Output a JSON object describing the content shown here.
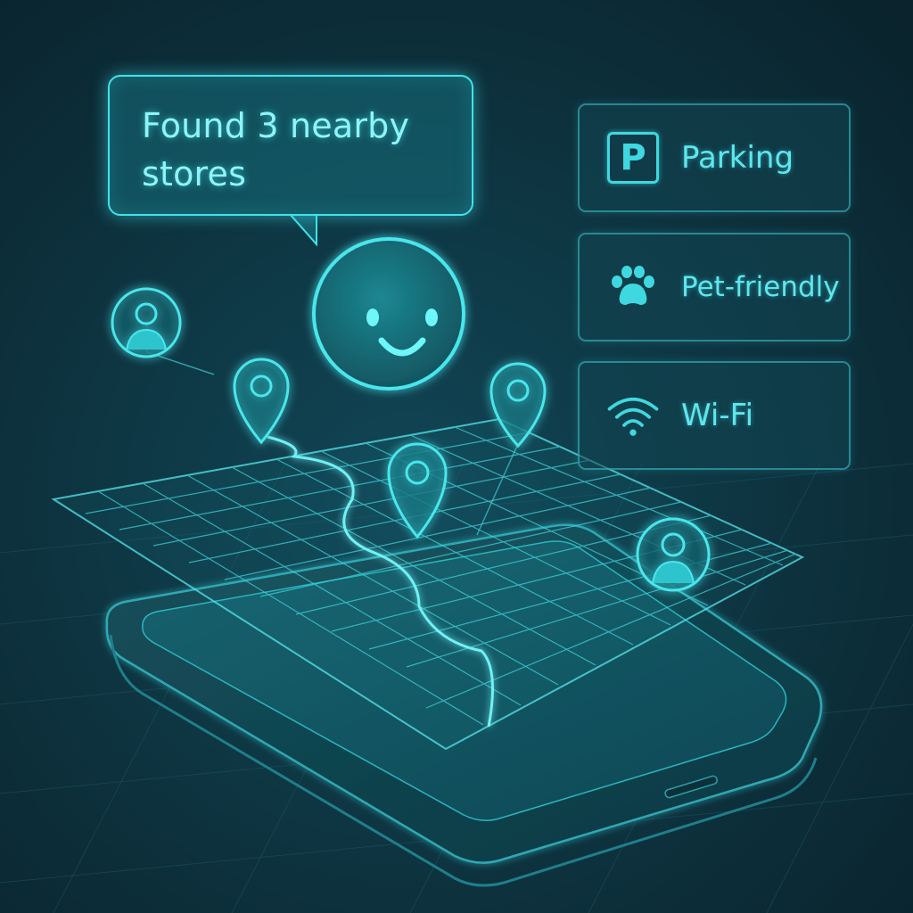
{
  "assistant": {
    "message": "Found 3 nearby stores"
  },
  "amenities": [
    {
      "label": "Parking",
      "icon": "parking-icon",
      "glyph": "P"
    },
    {
      "label": "Pet-friendly",
      "icon": "paw-icon"
    },
    {
      "label": "Wi-Fi",
      "icon": "wifi-icon"
    }
  ],
  "theme": {
    "background": "#0b2a33",
    "accent": "#3fe3ea",
    "text": "#5fe6ec"
  }
}
